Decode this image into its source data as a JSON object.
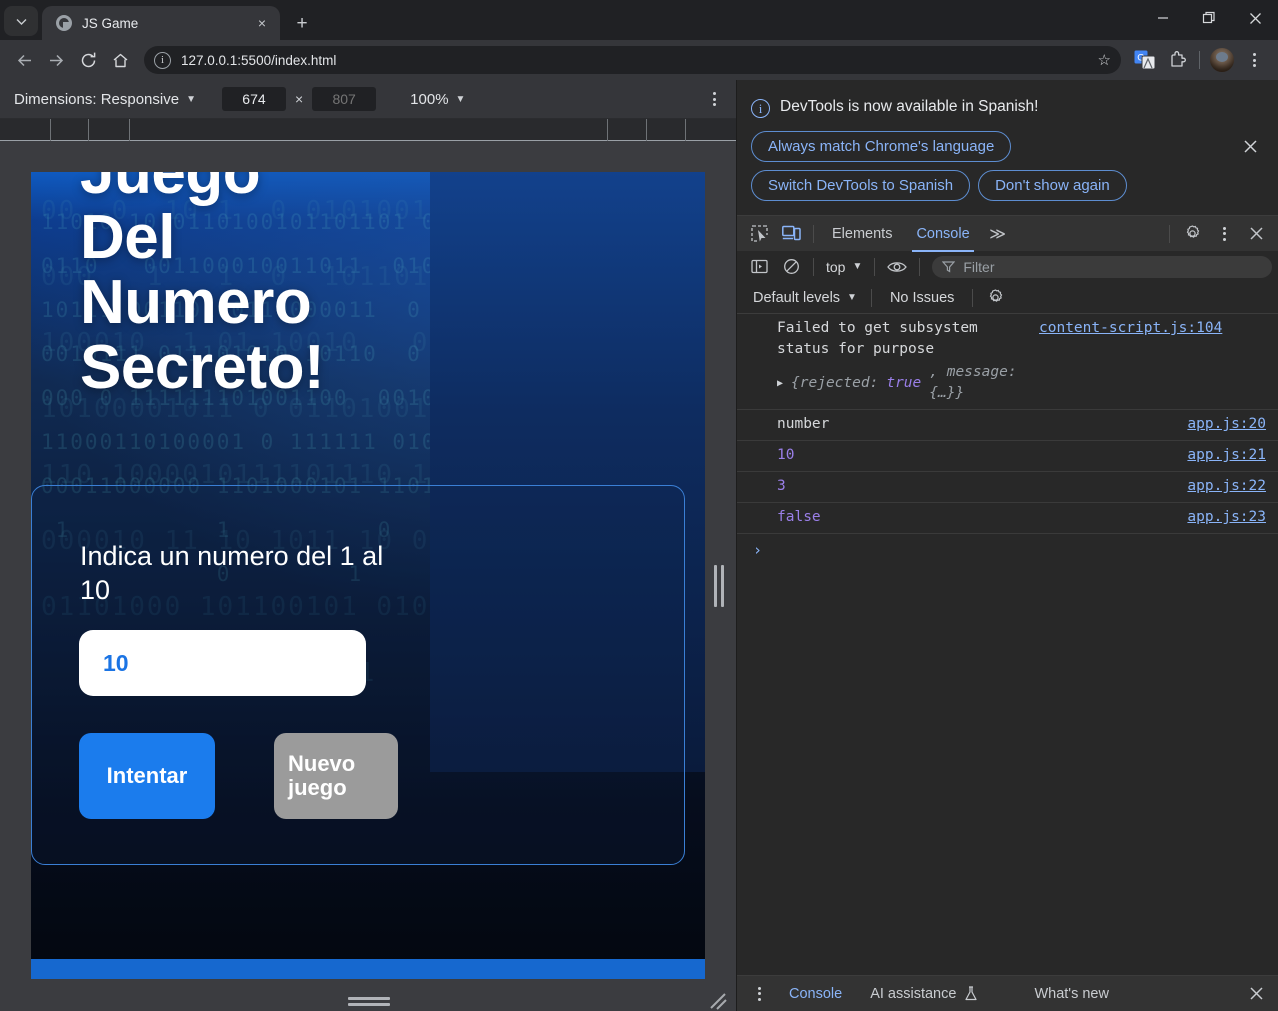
{
  "browser": {
    "tab": {
      "title": "JS Game",
      "close_label": "×",
      "favicon": "globe-icon"
    },
    "new_tab_label": "+",
    "tab_search_label": "⌄",
    "window": {
      "minimize": "–",
      "maximize": "⧉",
      "close": "✕"
    },
    "nav": {
      "back": "←",
      "forward": "→",
      "reload": "⟳",
      "home": "⌂"
    },
    "omnibox": {
      "url": "127.0.0.1:5500/index.html",
      "info_icon": "i",
      "bookmark_icon": "☆"
    },
    "toolbar_icons": [
      "translate-icon",
      "extensions-icon",
      "profile-avatar",
      "chrome-menu-icon"
    ]
  },
  "device_toolbar": {
    "dimensions_label": "Dimensions: Responsive",
    "width": "674",
    "height": "807",
    "height_placeholder": "807",
    "separator": "×",
    "zoom": "100%",
    "more_label": "more-options"
  },
  "page": {
    "headline": "Juego\nDel\nNumero\nSecreto!",
    "prompt": "Indica un numero del 1 al 10",
    "input_value": "10",
    "input_placeholder": "",
    "buttons": {
      "try": "Intentar",
      "new_game": "Nuevo juego"
    },
    "binary_rows": [
      "11010 10 0110100101101101 0 1 0",
      "00  0  10 1  0 010100100100 1 0",
      "0110   001100010011011  0100101",
      "000   1   1  0  101101001  1 00",
      "10111 00110100110000011  0  01",
      "100010  1 01 10010   0  0 1 000",
      "0010111 011101010 10110  0 1 11",
      "10100001011 0 011010010 01101 1",
      "000 0 111111101001100  001001 0",
      "110 1000010111101110 1 0 10 001",
      "11000110100001 0 111111 0100000",
      "000010 11 10 1011 10 0000 11011",
      "00011000000 1101000101 11011  0",
      "01101000 101100101 010 011000 0",
      " 1          1          0     01",
      "       0          1        0 1 ",
      "            0        1         "
    ]
  },
  "devtools": {
    "notification": {
      "icon": "info-icon",
      "message": "DevTools is now available in Spanish!",
      "buttons": [
        "Always match Chrome's language",
        "Switch DevTools to Spanish",
        "Don't show again"
      ],
      "close_label": "✕"
    },
    "tabs": {
      "inspect_icon": "inspect-element-icon",
      "device_icon": "device-toolbar-icon",
      "items": [
        "Elements",
        "Console"
      ],
      "selected": "Console",
      "overflow_label": "≫",
      "settings_icon": "gear-icon",
      "more_icon": "kebab-menu-icon",
      "close_label": "✕"
    },
    "toolbar": {
      "sidebar_icon": "console-sidebar-icon",
      "clear_icon": "clear-console-icon",
      "context": "top",
      "eye_icon": "live-expression-icon",
      "filter_placeholder": "Filter",
      "filter_icon": "filter-icon",
      "levels": "Default levels",
      "issues": "No Issues",
      "settings_icon": "console-settings-icon"
    },
    "messages": [
      {
        "type": "wrapped",
        "text": "Failed to get subsystem status for purpose",
        "source": "content-script.js:104",
        "object": {
          "prefix": "{rejected: ",
          "value": "true",
          "suffix": ", message: {…}}"
        }
      },
      {
        "type": "plain",
        "text": "number",
        "source": "app.js:20"
      },
      {
        "type": "number",
        "text": "10",
        "source": "app.js:21"
      },
      {
        "type": "number",
        "text": "3",
        "source": "app.js:22"
      },
      {
        "type": "number",
        "text": "false",
        "source": "app.js:23"
      }
    ],
    "prompt_caret": "›",
    "drawer": {
      "more_icon": "kebab-menu-icon",
      "tabs": [
        "Console",
        "AI assistance",
        "What's new"
      ],
      "selected": "Console",
      "ai_icon": "flask-icon",
      "close_label": "✕"
    }
  },
  "colors": {
    "accent_blue": "#1b7ced",
    "devtools_link": "#8ab4f8",
    "number_purple": "#9a7fe8",
    "new_game_gray": "#9b9b9b"
  }
}
